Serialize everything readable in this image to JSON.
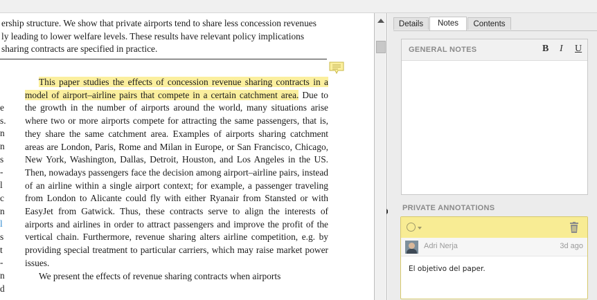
{
  "document": {
    "top_lines": [
      "ership structure. We show that private airports tend to share less concession revenues",
      "ly leading to lower welfare levels. These results have relevant policy implications",
      "sharing contracts are specified in practice."
    ],
    "highlight_text": "This paper studies the effects of concession revenue sharing contracts in a model of airport–airline pairs that compete in a certain catchment area.",
    "body_text": " Due to the growth in the number of airports around the world, many situations arise where two or more airports compete for attracting the same passengers, that is, they share the same catchment area. Examples of airports sharing catchment areas are London, Paris, Rome and Milan in Europe, or San Francisco, Chicago, New York, Washington, Dallas, Detroit, Houston, and Los Angeles in the US. Then, nowadays passengers face the decision among airport–airline pairs, instead of an airline within a single airport context; for example, a passenger traveling from London to Alicante could fly with either Ryanair from Stansted or with EasyJet from Gatwick. Thus, these contracts serve to align the interests of airports and airlines in order to attract passengers and improve the profit of the vertical chain. Furthermore, revenue sharing alters airline competition, e.g. by providing special treatment to particular carriers, which may raise market power issues.",
    "next_para": "We present the effects of revenue sharing contracts when airports",
    "left_fragments": [
      "e",
      "s.",
      "n",
      "n",
      "s",
      "-",
      "l",
      "c",
      "n",
      "l",
      "s",
      "t",
      "-",
      "n",
      "d",
      "-"
    ],
    "note_icon": "comment-note-icon"
  },
  "panel": {
    "tabs": [
      {
        "label": "Details"
      },
      {
        "label": "Notes"
      },
      {
        "label": "Contents"
      }
    ],
    "general_notes": {
      "title": "GENERAL NOTES",
      "bold": "B",
      "italic": "I",
      "underline": "U"
    },
    "private_annotations": {
      "title": "PRIVATE ANNOTATIONS",
      "user": "Adri Nerja",
      "time": "3d ago",
      "text": "El objetivo del paper.",
      "accent": "#f8ec94"
    }
  }
}
